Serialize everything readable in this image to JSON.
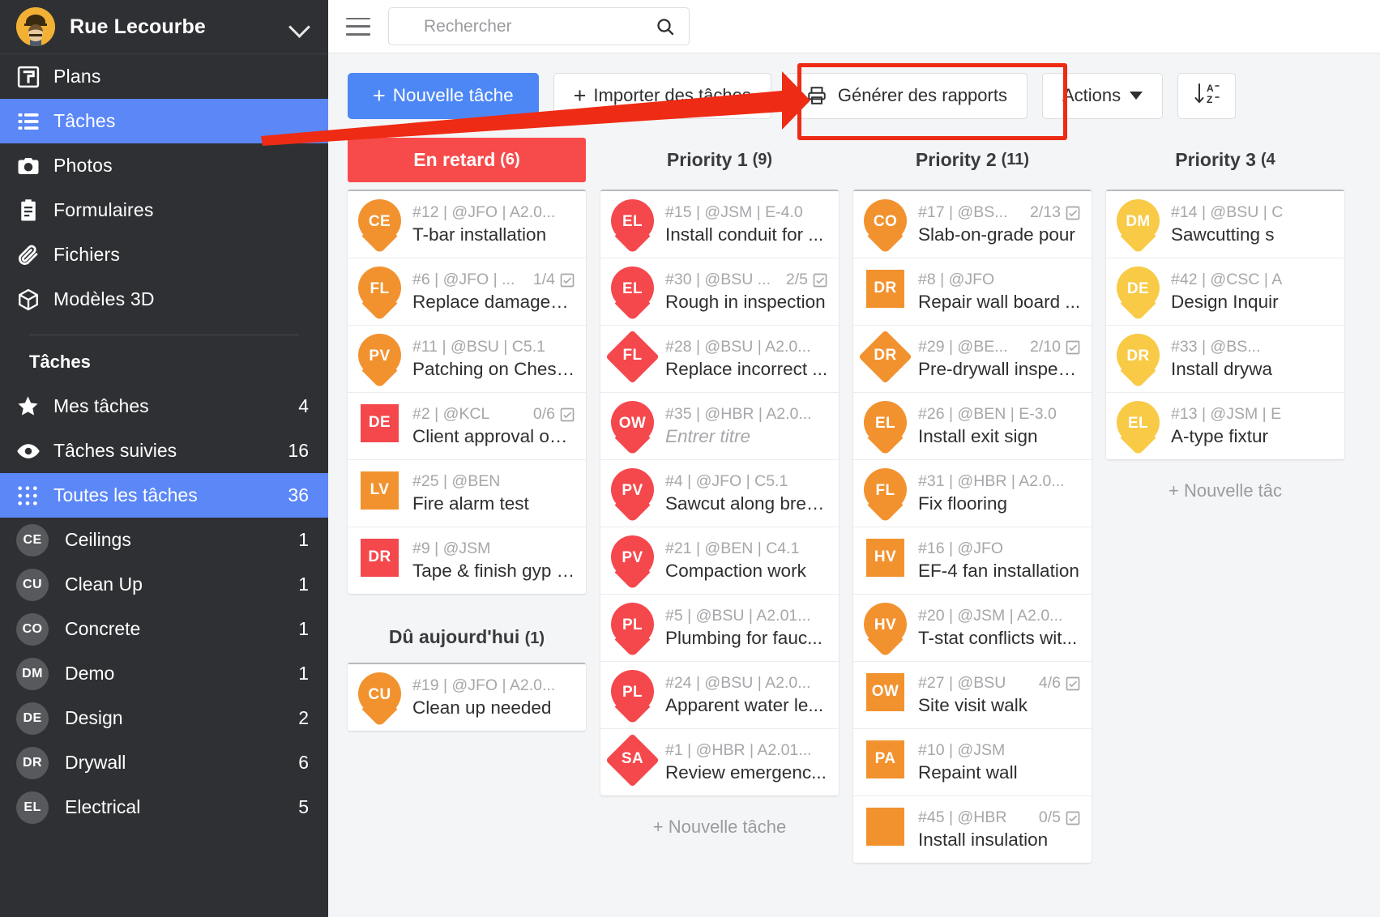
{
  "sidebar": {
    "project": {
      "name": "Rue Lecourbe",
      "avatar_icon": "worker-avatar",
      "chevron_icon": "chevron-down-icon"
    },
    "nav": [
      {
        "label": "Plans",
        "icon": "plan-icon",
        "active": false
      },
      {
        "label": "Tâches",
        "icon": "list-icon",
        "active": true
      },
      {
        "label": "Photos",
        "icon": "camera-icon",
        "active": false
      },
      {
        "label": "Formulaires",
        "icon": "clipboard-icon",
        "active": false
      },
      {
        "label": "Fichiers",
        "icon": "paperclip-icon",
        "active": false
      },
      {
        "label": "Modèles 3D",
        "icon": "cube-icon",
        "active": false
      }
    ],
    "section_title": "Tâches",
    "task_filters": [
      {
        "label": "Mes tâches",
        "count": "4",
        "icon": "star-icon",
        "active": false
      },
      {
        "label": "Tâches suivies",
        "count": "16",
        "icon": "eye-icon",
        "active": false
      },
      {
        "label": "Toutes les tâches",
        "count": "36",
        "icon": "grid-icon",
        "active": true
      }
    ],
    "categories": [
      {
        "code": "CE",
        "label": "Ceilings",
        "count": "1"
      },
      {
        "code": "CU",
        "label": "Clean Up",
        "count": "1"
      },
      {
        "code": "CO",
        "label": "Concrete",
        "count": "1"
      },
      {
        "code": "DM",
        "label": "Demo",
        "count": "1"
      },
      {
        "code": "DE",
        "label": "Design",
        "count": "2"
      },
      {
        "code": "DR",
        "label": "Drywall",
        "count": "6"
      },
      {
        "code": "EL",
        "label": "Electrical",
        "count": "5"
      }
    ]
  },
  "topbar": {
    "menu_icon": "hamburger-icon",
    "search": {
      "placeholder": "Rechercher",
      "value": "",
      "icon": "search-icon"
    }
  },
  "toolbar": {
    "new_task": "Nouvelle tâche",
    "import": "Importer des tâches",
    "generate_reports": "Générer des rapports",
    "actions": "Actions",
    "sort_icon": "sort-az-icon"
  },
  "annotation": {
    "highlight_color": "#ee2b14",
    "arrow_icon": "red-arrow-pointer"
  },
  "board": {
    "new_task_link": "+ Nouvelle tâche",
    "columns": [
      {
        "title": "En retard",
        "count": "(6)",
        "style": "overdue",
        "cards": [
          {
            "code": "CE",
            "shape": "pin",
            "color": "#f2922f",
            "ref": "#12 | @JFO | A2.0...",
            "title": "T-bar installation",
            "badge": ""
          },
          {
            "code": "FL",
            "shape": "pin",
            "color": "#f2922f",
            "ref": "#6 | @JFO | ...",
            "title": "Replace damaged ...",
            "badge": "1/4"
          },
          {
            "code": "PV",
            "shape": "pin",
            "color": "#f2922f",
            "ref": "#11 | @BSU | C5.1",
            "title": "Patching on Chest...",
            "badge": ""
          },
          {
            "code": "DE",
            "shape": "square",
            "color": "#f4484d",
            "ref": "#2 | @KCL",
            "title": "Client approval on ...",
            "badge": "0/6"
          },
          {
            "code": "LV",
            "shape": "square",
            "color": "#f2922f",
            "ref": "#25 | @BEN",
            "title": "Fire alarm test",
            "badge": ""
          },
          {
            "code": "DR",
            "shape": "square",
            "color": "#f4484d",
            "ref": "#9 | @JSM",
            "title": "Tape & finish gyp b...",
            "badge": ""
          }
        ],
        "group": {
          "title": "Dû aujourd'hui",
          "count": "(1)",
          "cards": [
            {
              "code": "CU",
              "shape": "pin",
              "color": "#f2922f",
              "ref": "#19 | @JFO | A2.0...",
              "title": "Clean up needed",
              "badge": ""
            }
          ]
        }
      },
      {
        "title": "Priority 1",
        "count": "(9)",
        "style": "plain",
        "cards": [
          {
            "code": "EL",
            "shape": "pin",
            "color": "#f4484d",
            "ref": "#15 | @JSM | E-4.0",
            "title": "Install conduit for ...",
            "badge": ""
          },
          {
            "code": "EL",
            "shape": "pin",
            "color": "#f4484d",
            "ref": "#30 | @BSU ...",
            "title": "Rough in inspection",
            "badge": "2/5"
          },
          {
            "code": "FL",
            "shape": "diamond",
            "color": "#f4484d",
            "ref": "#28 | @BSU | A2.0...",
            "title": "Replace incorrect ...",
            "badge": ""
          },
          {
            "code": "OW",
            "shape": "pin",
            "color": "#f4484d",
            "ref": "#35 | @HBR | A2.0...",
            "title": "Entrer titre",
            "title_placeholder": true,
            "badge": ""
          },
          {
            "code": "PV",
            "shape": "pin",
            "color": "#f4484d",
            "ref": "#4 | @JFO | C5.1",
            "title": "Sawcut along brea...",
            "badge": ""
          },
          {
            "code": "PV",
            "shape": "pin",
            "color": "#f4484d",
            "ref": "#21 | @BEN | C4.1",
            "title": "Compaction work",
            "badge": ""
          },
          {
            "code": "PL",
            "shape": "pin",
            "color": "#f4484d",
            "ref": "#5 | @BSU | A2.01...",
            "title": "Plumbing for fauc...",
            "badge": ""
          },
          {
            "code": "PL",
            "shape": "pin",
            "color": "#f4484d",
            "ref": "#24 | @BSU | A2.0...",
            "title": "Apparent water le...",
            "badge": ""
          },
          {
            "code": "SA",
            "shape": "diamond",
            "color": "#f4484d",
            "ref": "#1 | @HBR | A2.01...",
            "title": "Review emergenc...",
            "badge": ""
          }
        ]
      },
      {
        "title": "Priority 2",
        "count": "(11)",
        "style": "plain",
        "cards": [
          {
            "code": "CO",
            "shape": "pin",
            "color": "#f2922f",
            "ref": "#17 | @BS...",
            "title": "Slab-on-grade pour",
            "badge": "2/13"
          },
          {
            "code": "DR",
            "shape": "square",
            "color": "#f2922f",
            "ref": "#8 | @JFO",
            "title": "Repair wall board ...",
            "badge": ""
          },
          {
            "code": "DR",
            "shape": "diamond",
            "color": "#f2922f",
            "ref": "#29 | @BE...",
            "title": "Pre-drywall inspec...",
            "badge": "2/10"
          },
          {
            "code": "EL",
            "shape": "pin",
            "color": "#f2922f",
            "ref": "#26 | @BEN | E-3.0",
            "title": "Install exit sign",
            "badge": ""
          },
          {
            "code": "FL",
            "shape": "pin",
            "color": "#f2922f",
            "ref": "#31 | @HBR | A2.0...",
            "title": "Fix flooring",
            "badge": ""
          },
          {
            "code": "HV",
            "shape": "square",
            "color": "#f2922f",
            "ref": "#16 | @JFO",
            "title": "EF-4 fan installation",
            "badge": ""
          },
          {
            "code": "HV",
            "shape": "pin",
            "color": "#f2922f",
            "ref": "#20 | @JSM | A2.0...",
            "title": "T-stat conflicts wit...",
            "badge": ""
          },
          {
            "code": "OW",
            "shape": "square",
            "color": "#f2922f",
            "ref": "#27 | @BSU",
            "title": "Site visit walk",
            "badge": "4/6"
          },
          {
            "code": "PA",
            "shape": "square",
            "color": "#f2922f",
            "ref": "#10 | @JSM",
            "title": "Repaint wall",
            "badge": ""
          },
          {
            "code": "",
            "shape": "square",
            "color": "#f2922f",
            "ref": "#45 | @HBR",
            "title": "Install insulation",
            "badge": "0/5"
          }
        ]
      },
      {
        "title": "Priority 3",
        "count": "(4",
        "style": "plain",
        "cards": [
          {
            "code": "DM",
            "shape": "pin",
            "color": "#f8ca46",
            "ref": "#14 | @BSU | C",
            "title": "Sawcutting s",
            "badge": ""
          },
          {
            "code": "DE",
            "shape": "pin",
            "color": "#f8ca46",
            "ref": "#42 | @CSC | A",
            "title": "Design Inquir",
            "badge": ""
          },
          {
            "code": "DR",
            "shape": "pin",
            "color": "#f8ca46",
            "ref": "#33 | @BS...",
            "title": "Install drywa",
            "badge": ""
          },
          {
            "code": "EL",
            "shape": "pin",
            "color": "#f8ca46",
            "ref": "#13 | @JSM | E",
            "title": "A-type fixtur",
            "badge": ""
          }
        ],
        "new_task_link": "+ Nouvelle tâc"
      }
    ]
  }
}
